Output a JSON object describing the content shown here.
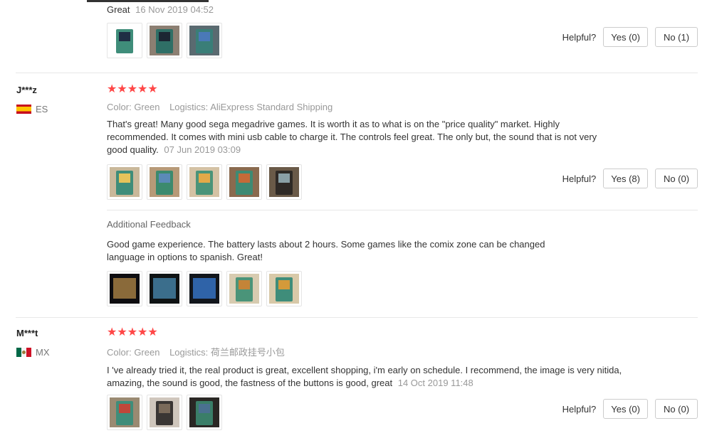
{
  "top_review": {
    "text": "Great",
    "date": "16 Nov 2019 04:52",
    "helpful_label": "Helpful?",
    "yes_label": "Yes (0)",
    "no_label": "No (1)",
    "thumb_count": 3
  },
  "reviews": [
    {
      "user": "J***z",
      "country": "ES",
      "stars": "★★★★★",
      "color_label": "Color:",
      "color_value": "Green",
      "logistics_label": "Logistics:",
      "logistics_value": "AliExpress Standard Shipping",
      "text": "That's great! Many good sega megadrive games. It is worth it as to what is on the \"price quality\" market. Highly recommended. It comes with mini usb cable to charge it. The controls feel great. The only but, the sound that is not very good quality.",
      "date": "07 Jun 2019 03:09",
      "helpful_label": "Helpful?",
      "yes_label": "Yes (8)",
      "no_label": "No (0)",
      "additional": {
        "title": "Additional Feedback",
        "text": "Good game experience. The battery lasts about 2 hours. Some games like the comix zone can be changed language in options to spanish. Great!"
      }
    },
    {
      "user": "M***t",
      "country": "MX",
      "stars": "★★★★★",
      "color_label": "Color:",
      "color_value": "Green",
      "logistics_label": "Logistics:",
      "logistics_value": "荷兰邮政挂号小包",
      "text": "I 've already tried it, the real product is great, excellent shopping, i'm early on schedule. I recommend, the image is very nitida, amazing, the sound is good, the fastness of the buttons is good, great",
      "date": "14 Oct 2019 11:48",
      "helpful_label": "Helpful?",
      "yes_label": "Yes (0)",
      "no_label": "No (0)"
    }
  ]
}
